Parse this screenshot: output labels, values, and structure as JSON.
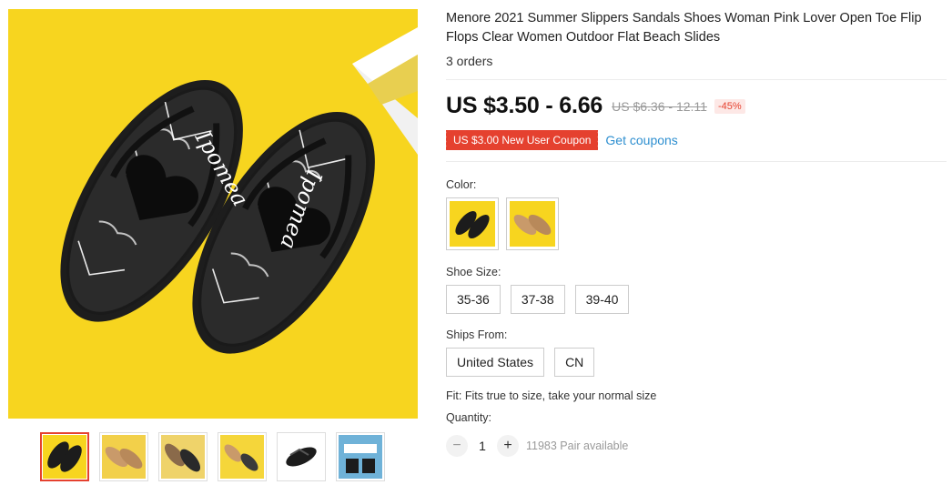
{
  "product": {
    "title": "Menore 2021 Summer Slippers Sandals Shoes Woman Pink Lover Open Toe Flip Flops Clear Women Outdoor Flat Beach Slides",
    "orders": "3 orders",
    "price": "US $3.50 - 6.66",
    "old_price": "US $6.36 - 12.11",
    "discount": "-45%",
    "coupon": "US $3.00 New User Coupon",
    "get_coupons": "Get coupons",
    "sole_text": "Ipomea"
  },
  "color": {
    "label": "Color:",
    "options": [
      {
        "name": "black-heart",
        "sole": "#1c1c1c",
        "accent": "#000000",
        "bg": "#f7d51f"
      },
      {
        "name": "gold-heart",
        "sole": "#c99a6a",
        "accent": "#d8b88a",
        "bg": "#f7d51f"
      }
    ]
  },
  "shoe_size": {
    "label": "Shoe Size:",
    "options": [
      "35-36",
      "37-38",
      "39-40"
    ]
  },
  "ships_from": {
    "label": "Ships From:",
    "options": [
      "United States",
      "CN"
    ]
  },
  "fit": "Fit: Fits true to size, take your normal size",
  "quantity": {
    "label": "Quantity:",
    "value": "1",
    "minus": "−",
    "plus": "+",
    "available": "11983 Pair available"
  },
  "colors_palette": {
    "accent_red": "#e5412f",
    "link_blue": "#2e8fd0",
    "image_yellow": "#f7d51f"
  },
  "thumbnails": [
    {
      "name": "thumb-black",
      "bg": "#f7d51f",
      "item": "#1c1c1c",
      "selected": true
    },
    {
      "name": "thumb-gold",
      "bg": "#f2d04a",
      "item": "#c99a6a",
      "selected": false
    },
    {
      "name": "thumb-gold-black",
      "bg": "#efd36a",
      "item": "#8a6a4a",
      "selected": false
    },
    {
      "name": "thumb-mixed",
      "bg": "#f5d63a",
      "item": "#3a3a3a",
      "selected": false
    },
    {
      "name": "thumb-white-bg",
      "bg": "#ffffff",
      "item": "#1c1c1c",
      "selected": false
    },
    {
      "name": "thumb-box",
      "bg": "#6fb2d8",
      "item": "#1c1c1c",
      "selected": false
    }
  ]
}
